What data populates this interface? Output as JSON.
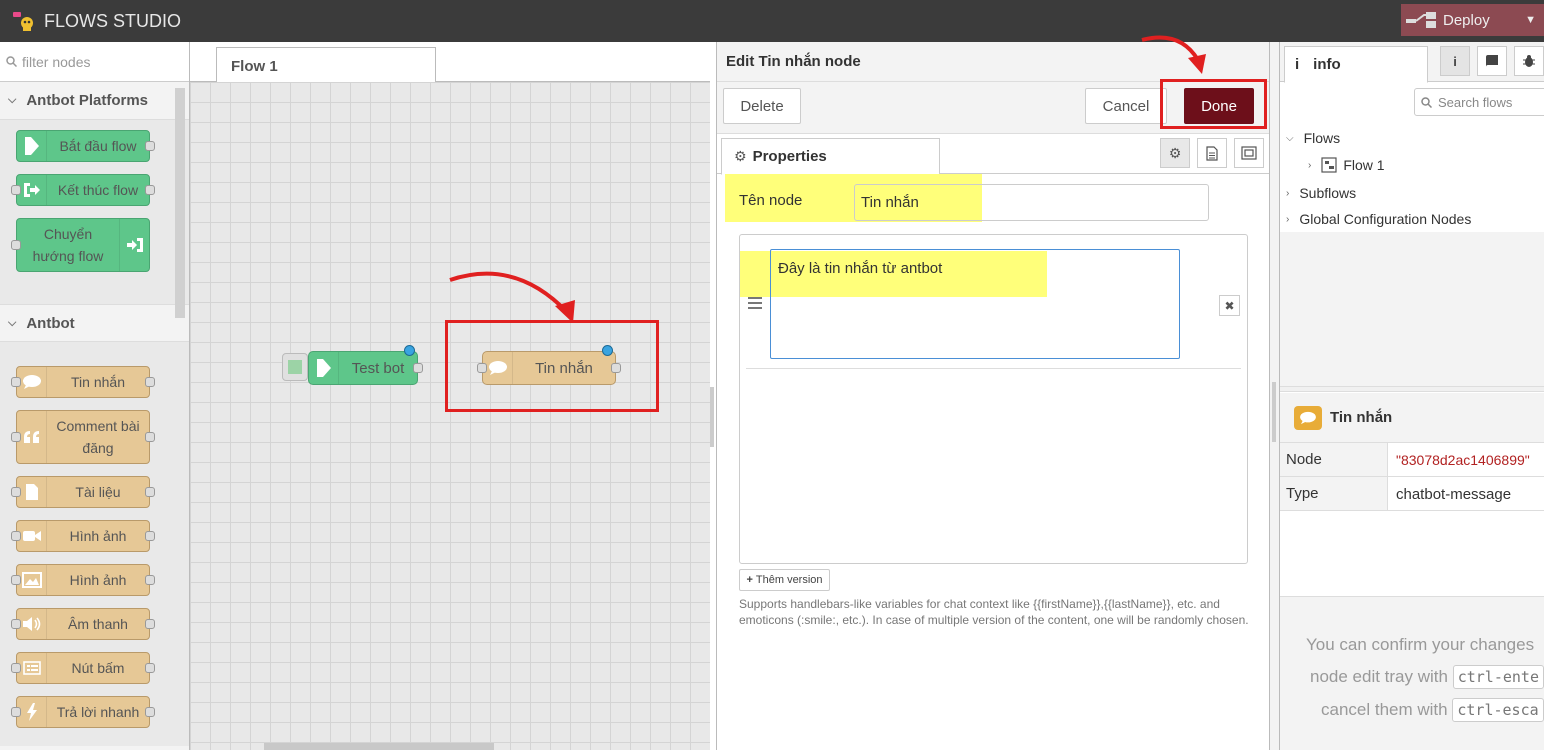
{
  "header": {
    "app_title": "FLOWS STUDIO",
    "deploy_label": "Deploy"
  },
  "palette": {
    "filter_placeholder": "filter nodes",
    "categories": [
      {
        "name": "Antbot Platforms",
        "nodes": [
          "Bắt đầu flow",
          "Kết thúc flow",
          "Chuyển hướng flow"
        ]
      },
      {
        "name": "Antbot",
        "nodes": [
          "Tin nhắn",
          "Comment bài đăng",
          "Tài liệu",
          "Hình ảnh",
          "Hình ảnh",
          "Âm thanh",
          "Nút bấm",
          "Trả lời nhanh"
        ]
      }
    ]
  },
  "workspace": {
    "tab_label": "Flow 1",
    "nodes": [
      {
        "label": "Test bot",
        "color": "#5ec68a"
      },
      {
        "label": "Tin nhắn",
        "color": "#e6c896"
      }
    ]
  },
  "editor": {
    "title": "Edit Tin nhắn node",
    "delete_label": "Delete",
    "cancel_label": "Cancel",
    "done_label": "Done",
    "properties_tab": "Properties",
    "name_label": "Tên node",
    "name_value": "Tin nhắn",
    "message_value": "Đây là tin nhắn từ antbot",
    "add_version_label": "Thêm version",
    "help_text": "Supports handlebars-like variables for chat context like {{firstName}},{{lastName}}, etc. and emoticons (:smile:, etc.). In case of multiple version of the content, one will be randomly chosen."
  },
  "sidebar": {
    "tab_info": "info",
    "search_placeholder": "Search flows",
    "tree": {
      "flows": "Flows",
      "flow1": "Flow 1",
      "subflows": "Subflows",
      "global_config": "Global Configuration Nodes"
    },
    "node_title": "Tin nhắn",
    "props": [
      {
        "key": "Node",
        "value": "\"83078d2ac1406899\""
      },
      {
        "key": "Type",
        "value": "chatbot-message"
      }
    ],
    "tip_line1": "You can confirm your changes",
    "tip_line2": "node edit tray with",
    "tip_kbd1": "ctrl-ente",
    "tip_line3": "cancel them with",
    "tip_kbd2": "ctrl-esca"
  },
  "colors": {
    "header_bg": "#3b3b3b",
    "deploy_bg": "#8c4a52",
    "done_bg": "#6d0f1a",
    "highlight": "#ffff7a",
    "annotation_red": "#e02020"
  }
}
